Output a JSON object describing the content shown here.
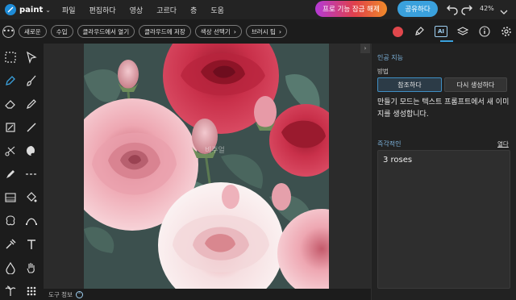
{
  "app": {
    "name": "paint"
  },
  "menu": [
    "파일",
    "편집하다",
    "영상",
    "고르다",
    "층",
    "도움"
  ],
  "topbar": {
    "unlock_label": "프로 기능 잠금 해제",
    "share_label": "공유하다",
    "zoom_text": "42%"
  },
  "subbar": {
    "chips": [
      {
        "label": "새로운",
        "arrow": ""
      },
      {
        "label": "수입",
        "arrow": ""
      },
      {
        "label": "클라우드에서 열기",
        "arrow": ""
      },
      {
        "label": "클라우드에 저장",
        "arrow": ""
      },
      {
        "label": "색상 선택기",
        "arrow": "›"
      },
      {
        "label": "브러시 팁",
        "arrow": "›"
      }
    ],
    "icons": [
      "color-swatch",
      "pen-icon",
      "ai-icon",
      "layers-icon",
      "info-icon",
      "gear-icon"
    ],
    "ai_icon_text": "AI",
    "active_color": "#e0474c"
  },
  "status": {
    "label": "도구 정보"
  },
  "panel": {
    "title": "인공 지능",
    "method_label": "방법",
    "mode_reference": "참조하다",
    "mode_regenerate": "다시 생성하다",
    "description": "만들기 모드는 텍스트 프롬프트에서 새 이미지를 생성합니다.",
    "prompt_label": "즉각적인",
    "prompt_open": "열다",
    "prompt_value": "3 roses"
  },
  "canvas": {
    "watermark": "비주얼"
  }
}
